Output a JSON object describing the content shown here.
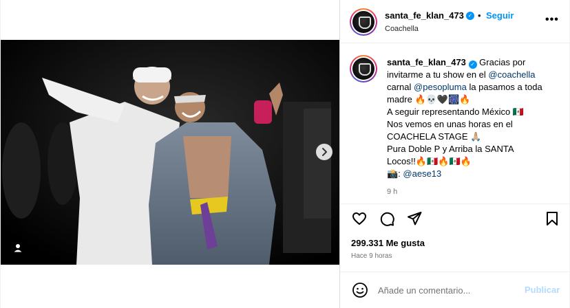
{
  "post": {
    "username": "santa_fe_klan_473",
    "location": "Coachella",
    "follow_label": "Seguir",
    "more_label": "•••",
    "dot_separator": "•"
  },
  "caption": {
    "username": "santa_fe_klan_473",
    "part1": "Gracias por invitarme a tu show en el ",
    "mention1": "@coachella",
    "part2": " carnal ",
    "mention2": "@pesopluma",
    "part3": " la pasamos a toda madre 🔥💀🖤🎆🔥",
    "line2": "A seguir representando México 🇲🇽",
    "line3": "Nos vemos en unas horas en el COACHELA STAGE 🙏🏼",
    "line4": "Pura Doble P y Arriba la SANTA",
    "line5": "Locos!!🔥🇲🇽🔥🇲🇽🔥",
    "line6_prefix": "📸: ",
    "mention3": "@aese13",
    "time": "9 h"
  },
  "stats": {
    "likes": "299.331 Me gusta",
    "ago": "Hace 9 horas"
  },
  "comment": {
    "placeholder": "Añade un comentario...",
    "publish_label": "Publicar"
  },
  "carousel": {
    "count": 12,
    "active_index": 0
  },
  "colors": {
    "accent": "#0095f6",
    "publish_disabled": "#b3dbff",
    "link": "#00376b"
  }
}
